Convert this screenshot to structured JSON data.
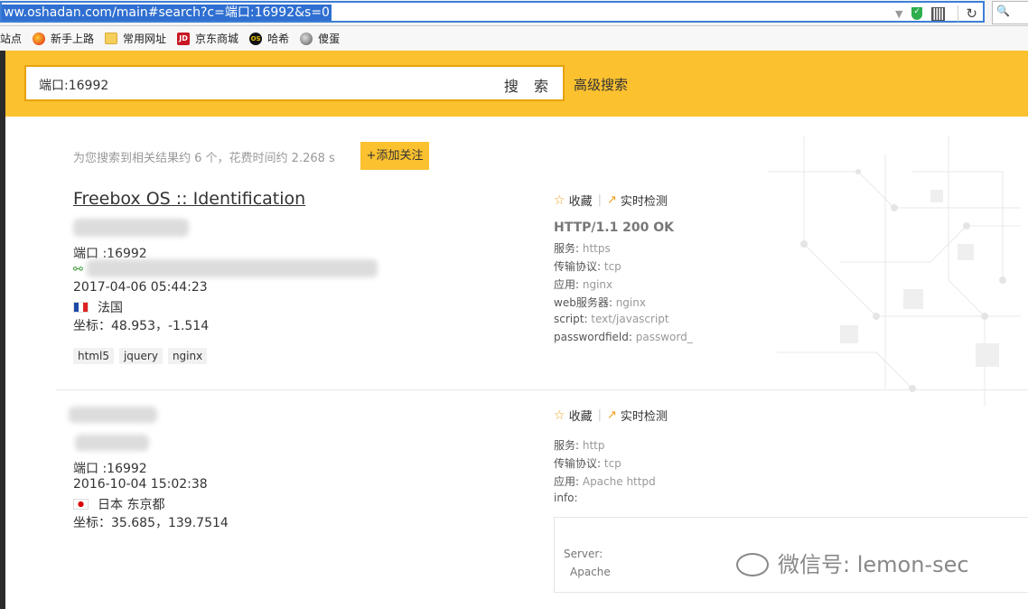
{
  "browser": {
    "url": "ww.oshadan.com/main#search?c=端口:16992&s=0",
    "bookmarks": [
      "站点",
      "新手上路",
      "常用网址",
      "京东商城",
      "哈希",
      "傻蛋"
    ],
    "bookmark_icons": [
      "firefox-icon",
      "folder-icon",
      "jd-icon",
      "os-icon",
      "globe-icon"
    ]
  },
  "search": {
    "query": "端口:16992",
    "button_label": "搜 索",
    "advanced_label": "高级搜索"
  },
  "summary": {
    "text": "为您搜索到相关结果约 6 个，花费时间约 2.268 s",
    "follow_label": "+添加关注"
  },
  "results": [
    {
      "title": "Freebox OS :: Identification",
      "port": "端口 :16992",
      "date": "2017-04-06 05:44:23",
      "country": "法国",
      "coords": "坐标：48.953，-1.514",
      "tags": [
        "html5",
        "jquery",
        "nginx"
      ],
      "favorite": "收藏",
      "realtime": "实时检测",
      "status": "HTTP/1.1 200 OK",
      "fields": [
        {
          "k": "服务: ",
          "v": "https"
        },
        {
          "k": "传输协议: ",
          "v": "tcp"
        },
        {
          "k": "应用: ",
          "v": "nginx"
        },
        {
          "k": "web服务器: ",
          "v": "nginx"
        },
        {
          "k": "script: ",
          "v": "text/javascript"
        },
        {
          "k": "passwordfield: ",
          "v": "password_"
        }
      ]
    },
    {
      "port": "端口 :16992",
      "date": "2016-10-04 15:02:38",
      "country": "日本 东京都",
      "coords": "坐标：35.685，139.7514",
      "favorite": "收藏",
      "realtime": "实时检测",
      "fields": [
        {
          "k": "服务: ",
          "v": "http"
        },
        {
          "k": "传输协议: ",
          "v": "tcp"
        },
        {
          "k": "应用: ",
          "v": "Apache httpd"
        },
        {
          "k": "info: ",
          "v": ""
        }
      ],
      "info_box": {
        "line1": "Server:",
        "line2": "Apache"
      }
    }
  ],
  "watermark": "微信号: lemon-sec"
}
